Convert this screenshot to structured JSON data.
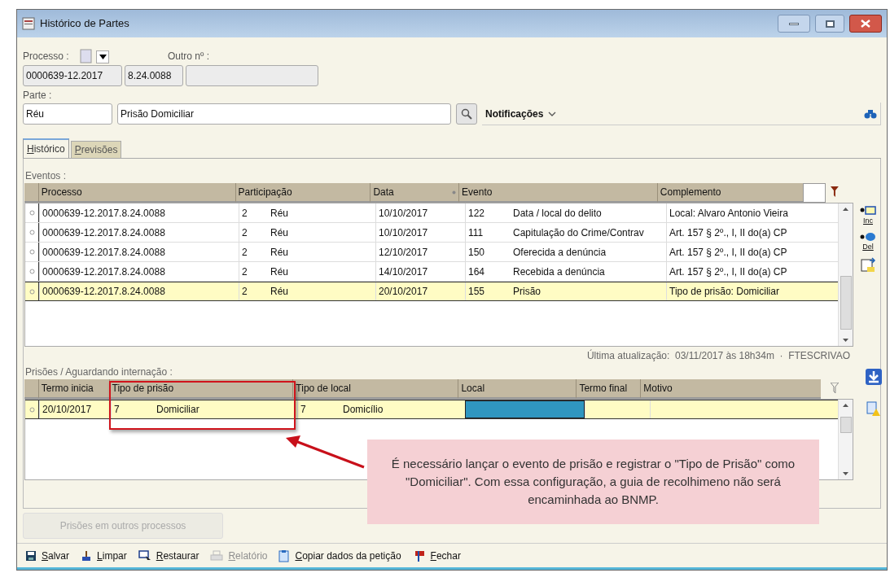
{
  "window": {
    "title": "Histórico de Partes"
  },
  "processo": {
    "label": "Processo :",
    "numero": "0000639-12.2017",
    "origem": "8.24.0088",
    "outro_label": "Outro nº :"
  },
  "parte": {
    "label": "Parte :",
    "tipo": "Réu",
    "nome": "Prisão Domiciliar",
    "notificacoes": "Notificações"
  },
  "tabs": [
    {
      "label": "Histórico",
      "selected": true
    },
    {
      "label": "Previsões",
      "selected": false
    }
  ],
  "eventos": {
    "label": "Eventos :",
    "columns": [
      "Processo",
      "Participação",
      "Data",
      "Evento",
      "Complemento"
    ],
    "rows": [
      {
        "selected": false,
        "cells": [
          "0000639-12.2017.8.24.0088",
          [
            "2",
            "Réu"
          ],
          "10/10/2017",
          [
            "122",
            "Data / local do delito"
          ],
          "Local: Alvaro Antonio Vieira"
        ]
      },
      {
        "selected": false,
        "cells": [
          "0000639-12.2017.8.24.0088",
          [
            "2",
            "Réu"
          ],
          "10/10/2017",
          [
            "111",
            "Capitulação do Crime/Contrav"
          ],
          "Art. 157 § 2º., I, II do(a) CP"
        ]
      },
      {
        "selected": false,
        "cells": [
          "0000639-12.2017.8.24.0088",
          [
            "2",
            "Réu"
          ],
          "12/10/2017",
          [
            "150",
            "Oferecida a denúncia"
          ],
          "Art. 157 § 2º., I, II do(a) CP"
        ]
      },
      {
        "selected": false,
        "cells": [
          "0000639-12.2017.8.24.0088",
          [
            "2",
            "Réu"
          ],
          "14/10/2017",
          [
            "164",
            "Recebida a denúncia"
          ],
          "Art. 157 § 2º., I, II do(a) CP"
        ]
      },
      {
        "selected": true,
        "cells": [
          "0000639-12.2017.8.24.0088",
          [
            "2",
            "Réu"
          ],
          "20/10/2017",
          [
            "155",
            "Prisão"
          ],
          "Tipo de prisão: Domiciliar"
        ]
      }
    ],
    "side_labels": [
      "Inc",
      "Del"
    ],
    "last_update": "Última atualização:  03/11/2017 às 18h34m  ·  FTESCRIVAO"
  },
  "prisoes": {
    "label": "Prisões / Aguardando internação :",
    "columns": [
      "Termo inicia",
      "Tipo de prisão",
      "Tipo de local",
      "Local",
      "Termo final",
      "Motivo"
    ],
    "rows": [
      {
        "selected": true,
        "cells": [
          {
            "text": "20/10/2017"
          },
          {
            "parts": [
              "7",
              "Domiciliar"
            ]
          },
          {
            "parts": [
              "7",
              "Domicílio"
            ]
          },
          {
            "focused": true
          },
          {},
          {}
        ]
      }
    ]
  },
  "outros_button": {
    "label": "Prisões em outros processos",
    "disabled": true
  },
  "toolbar": [
    {
      "kind": "save",
      "label": "Salvar",
      "disabled": false
    },
    {
      "kind": "clear",
      "label": "Limpar",
      "disabled": false
    },
    {
      "kind": "restore",
      "label": "Restaurar",
      "disabled": false
    },
    {
      "kind": "report",
      "label": "Relatório",
      "disabled": true
    },
    {
      "kind": "copy",
      "label": "Copiar dados da petição",
      "disabled": false
    },
    {
      "kind": "close",
      "label": "Fechar",
      "disabled": false
    }
  ],
  "annotation": {
    "text": "É necessário lançar o evento de prisão e registrar o \"Tipo de Prisão\" como \"Domiciliar\". Com essa configuração, a guia de recolhimeno não será encaminhada ao BNMP."
  }
}
